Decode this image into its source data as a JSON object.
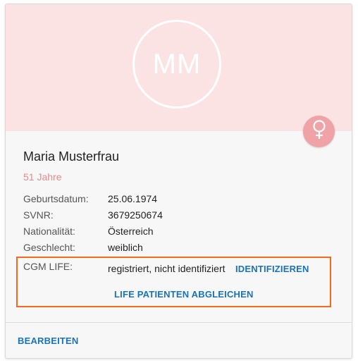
{
  "patient": {
    "initials": "MM",
    "name": "Maria Musterfrau",
    "age": "51 Jahre"
  },
  "fields": [
    {
      "label": "Geburtsdatum:",
      "value": "25.06.1974"
    },
    {
      "label": "SVNR:",
      "value": "3679250674"
    },
    {
      "label": "Nationalität:",
      "value": "Österreich"
    },
    {
      "label": "Geschlecht:",
      "value": "weiblich"
    }
  ],
  "cgm": {
    "label": "CGM LIFE:",
    "status": "registriert, nicht identifiziert",
    "identify_label": "IDENTIFIZIEREN",
    "sync_label": "LIFE PATIENTEN ABGLEICHEN"
  },
  "footer": {
    "edit_label": "BEARBEITEN"
  },
  "icons": {
    "gender": "female-symbol-icon"
  },
  "colors": {
    "banner": "#fbe3e4",
    "gender_badge": "#f0a3a6",
    "age_text": "#e48a8e",
    "link": "#1a73b8",
    "highlight": "#f26b1d"
  }
}
